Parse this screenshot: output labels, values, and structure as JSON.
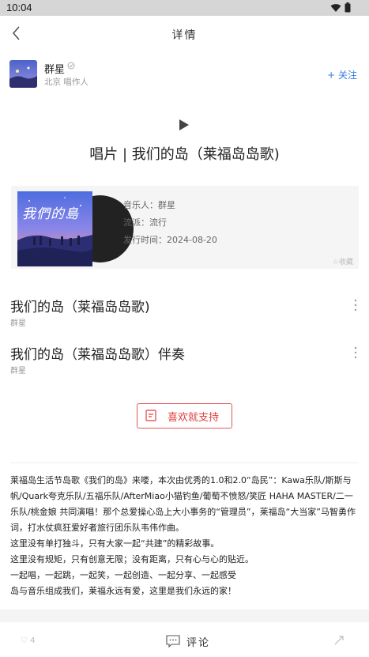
{
  "status_bar": {
    "time": "10:04"
  },
  "header": {
    "title": "详情"
  },
  "artist": {
    "name": "群星",
    "location_role": "北京 唱作人",
    "follow_label": "+ 关注"
  },
  "album": {
    "title": "唱片 | 我们的岛（莱福岛岛歌)",
    "cover_text": "我們的島",
    "musician": "音乐人：群星",
    "genre": "流派：流行",
    "release": "发行时间：2024-08-20",
    "collect_label": "收藏"
  },
  "songs": [
    {
      "title": "我们的岛（莱福岛岛歌)",
      "artist": "群星"
    },
    {
      "title": "我们的岛（莱福岛岛歌）伴奏",
      "artist": "群星"
    }
  ],
  "support_button": {
    "label": "喜欢就支持"
  },
  "description": [
    "莱福岛生活节岛歌《我们的岛》来喽，本次由优秀的1.0和2.0“岛民”：Kawa乐队/斯斯与帆/Quark夸克乐队/五福乐队/AfterMiao小猫钓鱼/葡萄不愤怒/笑匠 HAHA MASTER/二一乐队/桃金娘 共同演唱！那个总爱操心岛上大小事务的“管理员”，莱福岛“大当家”马智勇作词，打水仗疯狂爱好者旅行团乐队韦伟作曲。",
    "这里没有单打独斗，只有大家一起“共建”的精彩故事。",
    "这里没有规矩，只有创意无限；没有距离，只有心与心的贴近。",
    "一起唱，一起跳，一起笑，一起创造、一起分享、一起感受",
    "岛与音乐组成我们，莱福永远有爱，这里是我们永远的家！"
  ],
  "bottom_bar": {
    "like_count": "4",
    "comment_label": "评论"
  },
  "colors": {
    "accent_blue": "#3b7de2",
    "support_red": "#e0403f"
  }
}
